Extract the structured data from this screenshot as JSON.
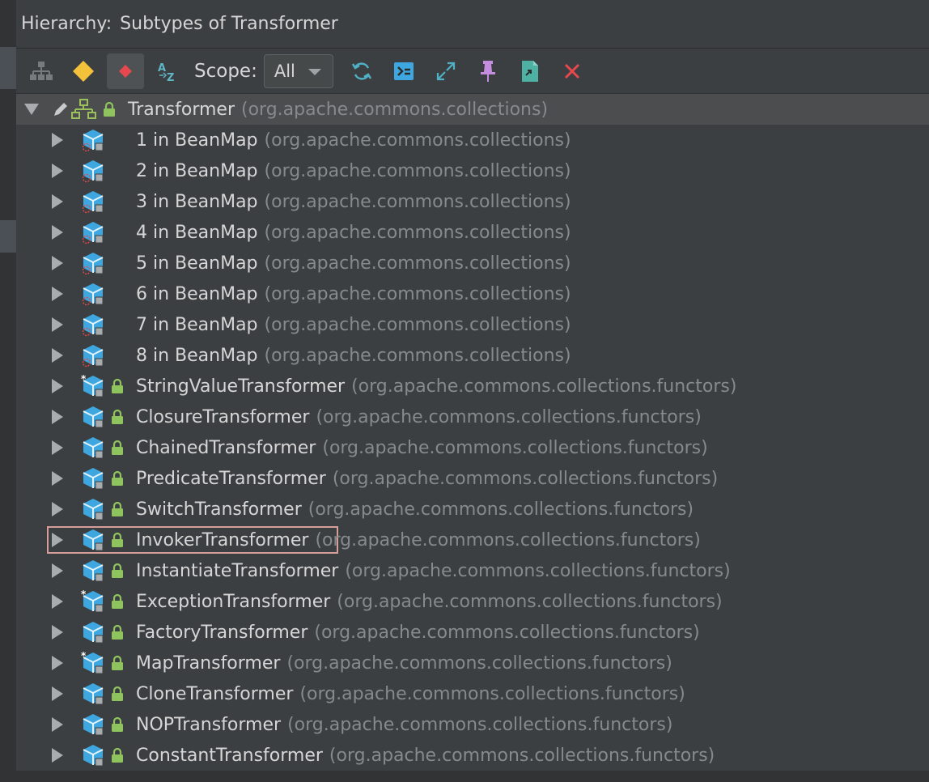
{
  "header": {
    "key": "Hierarchy:",
    "title": "Subtypes of Transformer"
  },
  "toolbar": {
    "buttons": [
      {
        "name": "class-hierarchy-icon"
      },
      {
        "name": "supertypes-icon"
      },
      {
        "name": "subtypes-icon"
      },
      {
        "name": "sort-alpha-icon"
      }
    ],
    "scope_label": "Scope:",
    "scope_value": "All",
    "actions": [
      {
        "name": "refresh-icon"
      },
      {
        "name": "autoscroll-source-icon"
      },
      {
        "name": "expand-all-icon"
      },
      {
        "name": "pin-icon"
      },
      {
        "name": "export-icon"
      },
      {
        "name": "close-icon"
      }
    ]
  },
  "tree": {
    "root": {
      "name": "Transformer",
      "package": "(org.apache.commons.collections)"
    },
    "children": [
      {
        "name": "1 in BeanMap",
        "package": "(org.apache.commons.collections)",
        "kind": "anonymous"
      },
      {
        "name": "2 in BeanMap",
        "package": "(org.apache.commons.collections)",
        "kind": "anonymous"
      },
      {
        "name": "3 in BeanMap",
        "package": "(org.apache.commons.collections)",
        "kind": "anonymous"
      },
      {
        "name": "4 in BeanMap",
        "package": "(org.apache.commons.collections)",
        "kind": "anonymous"
      },
      {
        "name": "5 in BeanMap",
        "package": "(org.apache.commons.collections)",
        "kind": "anonymous"
      },
      {
        "name": "6 in BeanMap",
        "package": "(org.apache.commons.collections)",
        "kind": "anonymous"
      },
      {
        "name": "7 in BeanMap",
        "package": "(org.apache.commons.collections)",
        "kind": "anonymous"
      },
      {
        "name": "8 in BeanMap",
        "package": "(org.apache.commons.collections)",
        "kind": "anonymous"
      },
      {
        "name": "StringValueTransformer",
        "package": "(org.apache.commons.collections.functors)",
        "kind": "static"
      },
      {
        "name": "ClosureTransformer",
        "package": "(org.apache.commons.collections.functors)",
        "kind": "class"
      },
      {
        "name": "ChainedTransformer",
        "package": "(org.apache.commons.collections.functors)",
        "kind": "class"
      },
      {
        "name": "PredicateTransformer",
        "package": "(org.apache.commons.collections.functors)",
        "kind": "class"
      },
      {
        "name": "SwitchTransformer",
        "package": "(org.apache.commons.collections.functors)",
        "kind": "class"
      },
      {
        "name": "InvokerTransformer",
        "package": "(org.apache.commons.collections.functors)",
        "kind": "class",
        "highlighted": true
      },
      {
        "name": "InstantiateTransformer",
        "package": "(org.apache.commons.collections.functors)",
        "kind": "class"
      },
      {
        "name": "ExceptionTransformer",
        "package": "(org.apache.commons.collections.functors)",
        "kind": "static"
      },
      {
        "name": "FactoryTransformer",
        "package": "(org.apache.commons.collections.functors)",
        "kind": "class"
      },
      {
        "name": "MapTransformer",
        "package": "(org.apache.commons.collections.functors)",
        "kind": "static"
      },
      {
        "name": "CloneTransformer",
        "package": "(org.apache.commons.collections.functors)",
        "kind": "class"
      },
      {
        "name": "NOPTransformer",
        "package": "(org.apache.commons.collections.functors)",
        "kind": "class"
      },
      {
        "name": "ConstantTransformer",
        "package": "(org.apache.commons.collections.functors)",
        "kind": "class"
      }
    ]
  },
  "colors": {
    "background": "#3c3f41",
    "text": "#d6d6d6",
    "package_text": "#868a8d",
    "class_icon": "#3fa7e0",
    "lock": "#8fc35e",
    "highlight_border": "#d69e9a"
  }
}
